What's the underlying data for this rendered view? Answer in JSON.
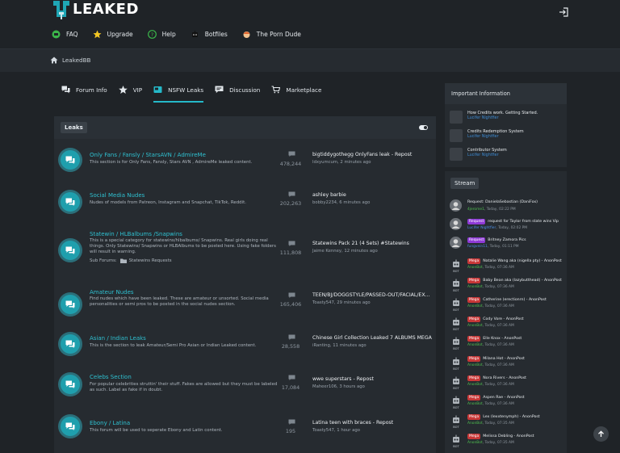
{
  "site": {
    "name": "LEAKED"
  },
  "topnav": [
    {
      "label": "FAQ",
      "icon": "faq-icon"
    },
    {
      "label": "Upgrade",
      "icon": "star-icon"
    },
    {
      "label": "Help",
      "icon": "help-icon"
    },
    {
      "label": "Botfiles",
      "icon": "bot-icon"
    },
    {
      "label": "The Porn Dude",
      "icon": "porn-dude-icon"
    }
  ],
  "breadcrumb": {
    "label": "LeakedBB"
  },
  "tabs": [
    {
      "label": "Forum Info",
      "icon": "forum-info-icon",
      "active": false
    },
    {
      "label": "VIP",
      "icon": "star-icon",
      "active": false
    },
    {
      "label": "NSFW Leaks",
      "icon": "nsfw-icon",
      "active": true
    },
    {
      "label": "Discussion",
      "icon": "discussion-icon",
      "active": false
    },
    {
      "label": "Marketplace",
      "icon": "cart-icon",
      "active": false
    }
  ],
  "forum": {
    "section_title": "Leaks",
    "rows": [
      {
        "title": "Only Fans / Fansly / StarsAVN / AdmireMe",
        "desc": "This section is for Only Fans, Fansly, Stars AVN , AdmireMe leaked content.",
        "count": "478,244",
        "last_title": "bigtiddygothegg OnlyFans leak - Repost",
        "last_meta": "ldxyumcum, 2 minutes ago"
      },
      {
        "title": "Social Media Nudes",
        "desc": "Nudes of models from Patreon, Instagram and Snapchat, TikTok, Reddit.",
        "count": "202,263",
        "last_title": "ashley barbie",
        "last_meta": "bobby2234, 6 minutes ago"
      },
      {
        "title": "Statewin / HLBalbums /Snapwins",
        "desc": "This is a special category for statewins/hlbalbums/ Snapwins. Real girls doing real things. Only Statewins/ Snapwins or HLBAlbums to be posted here. Using fake folders will result in warning.",
        "sub_label": "Sub Forums:",
        "sub_forum": "Statewins Requests",
        "count": "111,808",
        "last_title": "Statewins Pack 21 (4 Sets) #Statewins",
        "last_meta": "Jaime Kenney, 12 minutes ago"
      },
      {
        "title": "Amateur Nudes",
        "desc": "Find nudes which have been leaked. These are amateur or unsorted. Social media personalities or semi pros to be posted in the social nudes section.",
        "count": "165,406",
        "last_title": "TEEN/BJ/DOGGSTYLE/PASSED-OUT/FACIAL/EX...",
        "last_meta": "Toasty547, 29 minutes ago"
      },
      {
        "title": "Asian / Indian Leaks",
        "desc": "This is the section to leak Amateur/Semi Pro Asian or Indian Leaked content.",
        "count": "28,558",
        "last_title": "Chinese Girl Collection Leaked 7 ALBUMS MEGA",
        "last_meta": "iRanting, 11 minutes ago"
      },
      {
        "title": "Celebs Section",
        "desc": "For popular celebrities struttin' their stuff. Fakes are allowed but they must be labeled as such. Label as fake if in doubt.",
        "count": "17,084",
        "last_title": "wwe superstars - Repost",
        "last_meta": "Maheer106, 3 hours ago"
      },
      {
        "title": "Ebony / Latina",
        "desc": "This forum will be used to seperate Ebony and Latin content.",
        "count": "195",
        "last_title": "Latina teen with braces - Repost",
        "last_meta": "Toasty547, 1 hour ago"
      }
    ]
  },
  "important": {
    "title": "Important Information",
    "items": [
      {
        "title": "How Credits work. Getting Started.",
        "author": "Lucifer Nightfier"
      },
      {
        "title": "Credits Redemption System",
        "author": "Lucifer Nightfier"
      },
      {
        "title": "Contributor System",
        "author": "Lucifer Nightfier"
      }
    ]
  },
  "stream": {
    "title": "Stream",
    "items": [
      {
        "tag": "",
        "text": "Request: DanielaSebastian (DaniFox)",
        "user": "4jerome1",
        "user_color": "green",
        "time": "Today, 02:22 PM",
        "avatar": "person"
      },
      {
        "tag": "Request",
        "text": "request for Taylor from state wins Vip",
        "user": "Lucifer Nightfier",
        "user_color": "blue",
        "time": "Today, 02:02 PM",
        "avatar": "person"
      },
      {
        "tag": "Request",
        "text": "Britney Zamora Pics",
        "user": "fungvein11",
        "user_color": "blue",
        "time": "Today, 01:11 PM",
        "avatar": "person"
      },
      {
        "tag": "Mega",
        "text": "Natalie Wang aka (nigella pty) - AnonPost",
        "user": "AnonBot",
        "user_color": "green",
        "time": "Today, 07:36 AM",
        "avatar": "bot"
      },
      {
        "tag": "Mega",
        "text": "Baby Bean aka (lazybutthead) - AnonPost",
        "user": "AnonBot",
        "user_color": "green",
        "time": "Today, 07:36 AM",
        "avatar": "bot"
      },
      {
        "tag": "Mega",
        "text": "Catherine (erectionrn) - AnonPost",
        "user": "AnonBot",
        "user_color": "green",
        "time": "Today, 07:36 AM",
        "avatar": "bot"
      },
      {
        "tag": "Mega",
        "text": "Cody Vore - AnonPost",
        "user": "AnonBot",
        "user_color": "green",
        "time": "Today, 07:36 AM",
        "avatar": "bot"
      },
      {
        "tag": "Mega",
        "text": "Elle Knox - AnonPost",
        "user": "AnonBot",
        "user_color": "green",
        "time": "Today, 07:36 AM",
        "avatar": "bot"
      },
      {
        "tag": "Mega",
        "text": "Milana Hot - AnonPost",
        "user": "AnonBot",
        "user_color": "green",
        "time": "Today, 07:36 AM",
        "avatar": "bot"
      },
      {
        "tag": "Mega",
        "text": "Nora Rivers - AnonPost",
        "user": "AnonBot",
        "user_color": "green",
        "time": "Today, 07:36 AM",
        "avatar": "bot"
      },
      {
        "tag": "Mega",
        "text": "Aspen Rae - AnonPost",
        "user": "AnonBot",
        "user_color": "green",
        "time": "Today, 07:36 AM",
        "avatar": "bot"
      },
      {
        "tag": "Mega",
        "text": "Lex (lexxtenymph) - AnonPost",
        "user": "AnonBot",
        "user_color": "green",
        "time": "Today, 07:35 AM",
        "avatar": "bot"
      },
      {
        "tag": "Mega",
        "text": "Melissa Debling - AnonPost",
        "user": "AnonBot",
        "user_color": "green",
        "time": "Today, 07:35 AM",
        "avatar": "bot"
      }
    ],
    "bot_label": "BOT"
  },
  "colors": {
    "accent": "#25b9c9",
    "background": "#1f2327",
    "panel": "#262b30",
    "request_tag": "#8e3ad6",
    "mega_tag": "#c73737"
  }
}
